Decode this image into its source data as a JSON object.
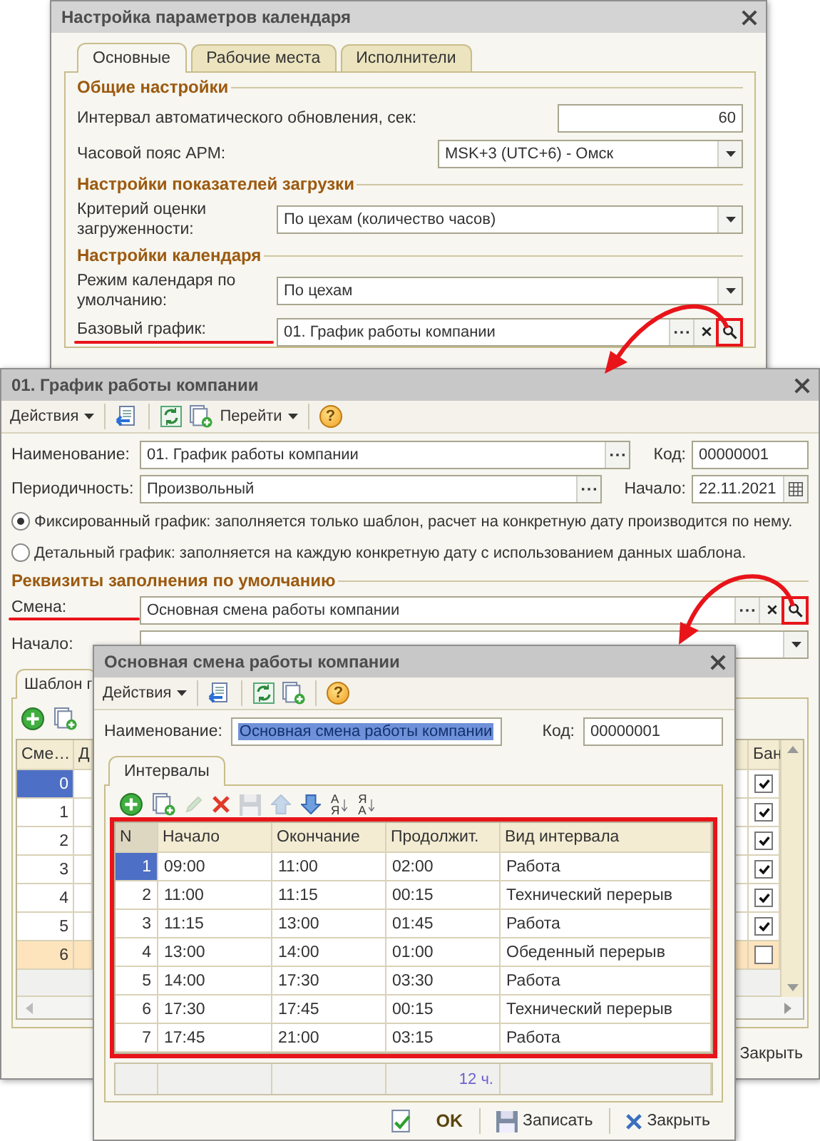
{
  "settings_window": {
    "title": "Настройка параметров календаря",
    "tabs": [
      {
        "label": "Основные",
        "selected": true
      },
      {
        "label": "Рабочие места",
        "selected": false
      },
      {
        "label": "Исполнители",
        "selected": false
      }
    ],
    "sections": [
      {
        "heading": "Общие настройки",
        "fields": [
          {
            "kind": "number",
            "label": "Интервал автоматического обновления, сек:",
            "value": "60"
          },
          {
            "kind": "select",
            "label": "Часовой пояс АРМ:",
            "value": "MSK+3 (UTC+6) - Омск"
          }
        ]
      },
      {
        "heading": "Настройки показателей загрузки",
        "fields": [
          {
            "kind": "select",
            "label": "Критерий оценки загруженности:",
            "value": "По цехам (количество часов)"
          }
        ]
      },
      {
        "heading": "Настройки календаря",
        "fields": [
          {
            "kind": "select",
            "label": "Режим календаря по умолчанию:",
            "value": "По цехам"
          },
          {
            "kind": "lookup",
            "label": "Базовый график:",
            "value": "01. График работы компании",
            "annotated": true
          }
        ]
      }
    ]
  },
  "schedule_window": {
    "title": "01. График работы компании",
    "toolbar": [
      [
        {
          "kind": "menu",
          "label": "Действия"
        }
      ],
      [
        {
          "kind": "post"
        }
      ],
      [
        {
          "kind": "refresh"
        },
        {
          "kind": "copy"
        },
        {
          "kind": "menu",
          "label": "Перейти"
        }
      ],
      [
        {
          "kind": "help",
          "glyph": "?"
        }
      ]
    ],
    "field_rows": [
      [
        {
          "kind": "more",
          "label": "Наименование:",
          "value": "01. График работы компании"
        },
        {
          "kind": "text",
          "label": "Код:",
          "value": "00000001"
        }
      ],
      [
        {
          "kind": "more",
          "label": "Периодичность:",
          "value": "Произвольный"
        },
        {
          "kind": "date",
          "label": "Начало:",
          "value": "22.11.2021"
        }
      ]
    ],
    "radios": [
      {
        "label": "Фиксированный график: заполняется только шаблон, расчет на конкретную дату производится по нему.",
        "selected": true
      },
      {
        "label": "Детальный график: заполняется на каждую конкретную дату с использованием данных шаблона.",
        "selected": false
      }
    ],
    "section": "Реквизиты заполнения по умолчанию",
    "defaults": [
      {
        "kind": "lookup",
        "label": "Смена:",
        "value": "Основная смена работы компании",
        "annotated": true
      },
      {
        "kind": "select",
        "label": "Начало:",
        "annotated": false
      }
    ],
    "tab": {
      "label": "Шаблон г",
      "selected": true
    },
    "table_toolbar": [
      {
        "kind": "add",
        "disabled": false
      },
      {
        "kind": "copy",
        "disabled": false
      }
    ],
    "table": {
      "columns": [
        "Сме…",
        "Д"
      ],
      "last_column": "Бан",
      "rows": [
        {
          "number": "0",
          "selected": true,
          "marked": false,
          "checked": true
        },
        {
          "number": "1",
          "selected": false,
          "marked": false,
          "checked": true
        },
        {
          "number": "2",
          "selected": false,
          "marked": false,
          "checked": true
        },
        {
          "number": "3",
          "selected": false,
          "marked": false,
          "checked": true
        },
        {
          "number": "4",
          "selected": false,
          "marked": false,
          "checked": true
        },
        {
          "number": "5",
          "selected": false,
          "marked": false,
          "checked": true
        },
        {
          "number": "6",
          "selected": false,
          "marked": true,
          "checked": false
        }
      ]
    },
    "close_button": "Закрыть"
  },
  "shift_window": {
    "title": "Основная смена работы компании",
    "toolbar": [
      [
        {
          "kind": "menu",
          "label": "Действия"
        }
      ],
      [
        {
          "kind": "post"
        }
      ],
      [
        {
          "kind": "refresh"
        },
        {
          "kind": "copy"
        }
      ],
      [
        {
          "kind": "help",
          "glyph": "?"
        }
      ]
    ],
    "name": {
      "label": "Наименование:",
      "value": "Основная смена работы компании",
      "text_selected": true
    },
    "code": {
      "label": "Код:",
      "value": "00000001"
    },
    "tab": {
      "label": "Интервалы",
      "selected": true
    },
    "table_toolbar": [
      {
        "kind": "add",
        "disabled": false
      },
      {
        "kind": "copy",
        "disabled": false
      },
      {
        "kind": "edit",
        "disabled": true
      },
      {
        "kind": "delete",
        "disabled": false
      },
      {
        "kind": "save",
        "disabled": true
      },
      {
        "kind": "up",
        "disabled": true
      },
      {
        "kind": "down",
        "disabled": false
      },
      {
        "kind": "sort",
        "letters": [
          "А",
          "Я"
        ],
        "disabled": false
      },
      {
        "kind": "sort",
        "letters": [
          "Я",
          "А"
        ],
        "disabled": false
      }
    ],
    "table": {
      "highlighted": true,
      "columns": [
        "N",
        "Начало",
        "Окончание",
        "Продолжит.",
        "Вид интервала"
      ],
      "rows": [
        {
          "number": "1",
          "start": "09:00",
          "end": "11:00",
          "duration": "02:00",
          "type": "Работа",
          "selected": true
        },
        {
          "number": "2",
          "start": "11:00",
          "end": "11:15",
          "duration": "00:15",
          "type": "Технический перерыв",
          "selected": false
        },
        {
          "number": "3",
          "start": "11:15",
          "end": "13:00",
          "duration": "01:45",
          "type": "Работа",
          "selected": false
        },
        {
          "number": "4",
          "start": "13:00",
          "end": "14:00",
          "duration": "01:00",
          "type": "Обеденный перерыв",
          "selected": false
        },
        {
          "number": "5",
          "start": "14:00",
          "end": "17:30",
          "duration": "03:30",
          "type": "Работа",
          "selected": false
        },
        {
          "number": "6",
          "start": "17:30",
          "end": "17:45",
          "duration": "00:15",
          "type": "Технический перерыв",
          "selected": false
        },
        {
          "number": "7",
          "start": "17:45",
          "end": "21:00",
          "duration": "03:15",
          "type": "Работа",
          "selected": false
        }
      ],
      "total": "12 ч."
    },
    "buttons": [
      {
        "kind": "ok",
        "label": "OK"
      },
      {
        "kind": "save",
        "label": "Записать"
      },
      {
        "kind": "close",
        "label": "Закрыть"
      }
    ]
  }
}
